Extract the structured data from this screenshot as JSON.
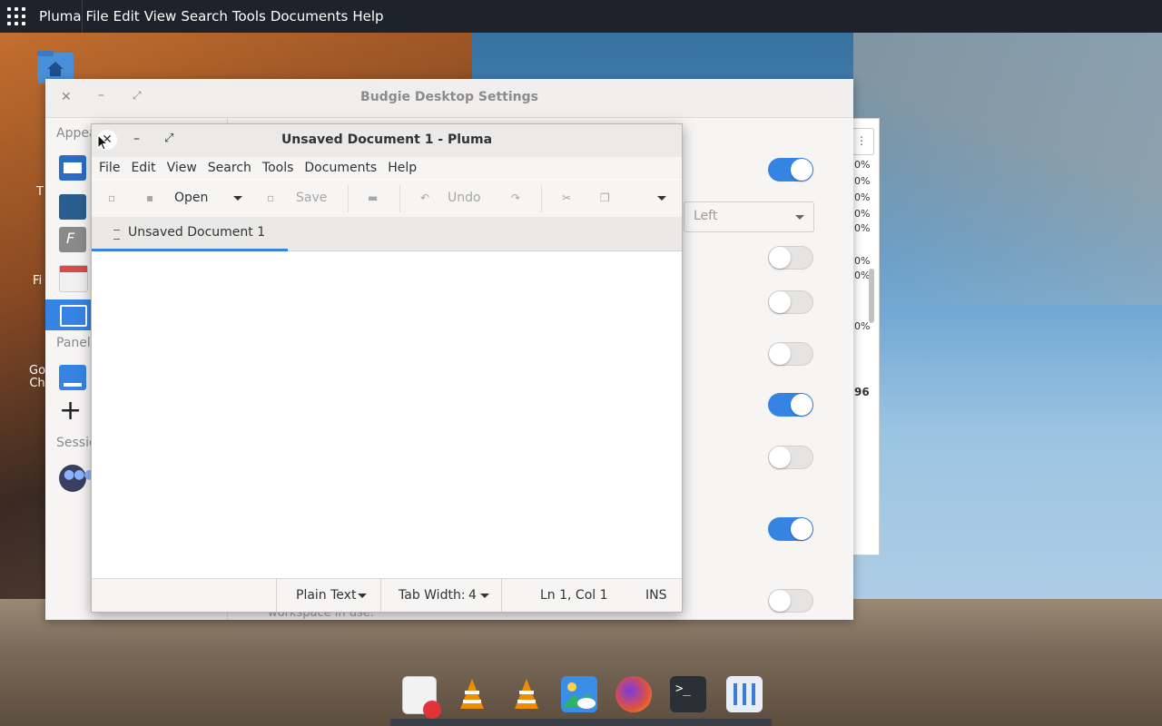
{
  "topbar": {
    "app_name": "Pluma",
    "menu": [
      "File",
      "Edit",
      "View",
      "Search",
      "Tools",
      "Documents",
      "Help"
    ]
  },
  "desktop_icons": {
    "trash_label": "T",
    "files_label": "Fi",
    "chrome_label": "Go\nCh"
  },
  "budgie": {
    "title": "Budgie Desktop Settings",
    "sections": {
      "appearance": "Appea",
      "panels": "Panels",
      "session": "Sessio"
    },
    "dropdown_value": "Left",
    "hint_text": "workspace in use.",
    "toggles": [
      "on",
      "off",
      "off",
      "off",
      "on",
      "off",
      "on",
      "off"
    ]
  },
  "bg_window": {
    "values": [
      "0%",
      "0%",
      "0%",
      "0%",
      "0%",
      "0%",
      "0%",
      "0%",
      "96"
    ]
  },
  "pluma": {
    "title": "Unsaved Document 1 - Pluma",
    "menu": {
      "file": "File",
      "edit": "Edit",
      "view": "View",
      "search": "Search",
      "tools": "Tools",
      "documents": "Documents",
      "help": "Help"
    },
    "toolbar": {
      "open": "Open",
      "save": "Save",
      "undo": "Undo"
    },
    "tab_label": "Unsaved Document 1",
    "status": {
      "language": "Plain Text",
      "tab_width_label": "Tab Width:",
      "tab_width_value": "4",
      "position": "Ln 1, Col 1",
      "mode": "INS"
    }
  },
  "dock": {
    "apps": [
      "text-editor-icon",
      "vlc-icon",
      "vlc-icon",
      "image-viewer-icon",
      "firefox-icon",
      "terminal-icon",
      "settings-icon"
    ]
  },
  "colors": {
    "accent": "#3584e4",
    "topbar": "#1e232b"
  }
}
